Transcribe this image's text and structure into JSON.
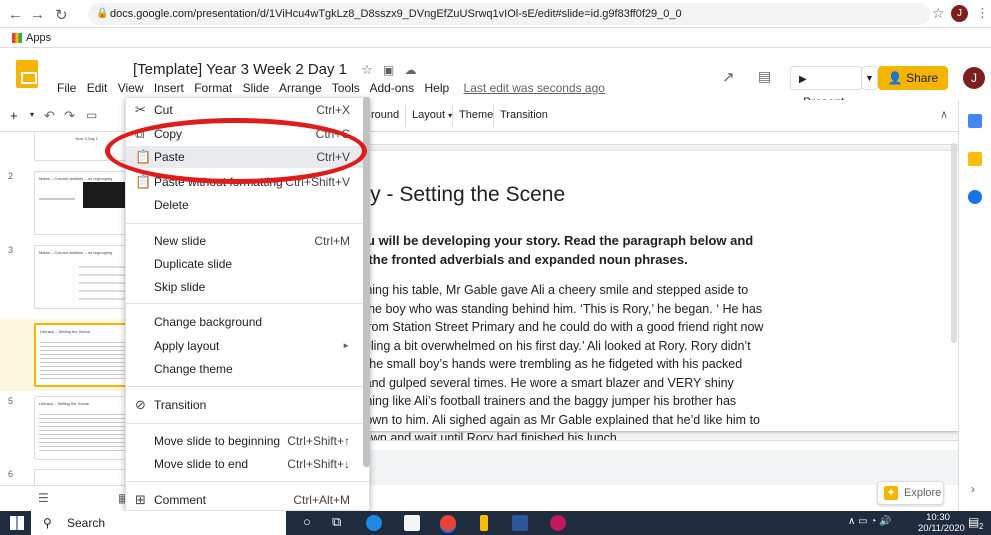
{
  "browser": {
    "url": "docs.google.com/presentation/d/1ViHcu4wTgkLz8_D8sszx9_DVngEfZuUSrwq1vIOl-sE/edit#slide=id.g9f83ff0f29_0_0",
    "bookmarks_label": "Apps",
    "profile_initial": "J"
  },
  "app": {
    "title": "[Template] Year 3 Week 2 Day 1",
    "menus": [
      "File",
      "Edit",
      "View",
      "Insert",
      "Format",
      "Slide",
      "Arrange",
      "Tools",
      "Add-ons",
      "Help"
    ],
    "last_edit": "Last edit was seconds ago",
    "present_label": "Present",
    "share_label": "Share",
    "user_initial": "J"
  },
  "toolbar": {
    "background_label": "round",
    "layout_label": "Layout",
    "theme_label": "Theme",
    "transition_label": "Transition"
  },
  "filmstrip": {
    "slides": [
      {
        "num": "",
        "title": "Year 3 Day 1"
      },
      {
        "num": "2",
        "title": "Maths – Column addition – no regrouping"
      },
      {
        "num": "3",
        "title": "Maths – Column addition – no regrouping"
      },
      {
        "num": "4",
        "title": "Literacy – Setting the Scene"
      },
      {
        "num": "5",
        "title": "Literacy – Setting the Scene"
      },
      {
        "num": "6",
        "title": ""
      }
    ]
  },
  "slide": {
    "title": "racy - Setting the Scene",
    "bold_text": "y you will be developing your story. Read the paragraph below and ight the fronted adverbials and expanded noun phrases.",
    "lines": [
      "reaching his table, Mr Gable gave Ali a cheery smile and stepped aside to",
      "uce the boy who was standing behind him. ‘This is Rory,’ he began. ‘ He has",
      "l us from Station Street Primary and he could do with a good friend right now",
      "is feeling a bit overwhelmed on his first day.’ Ali looked at Rory. Rory didn’t",
      "up. The small boy’s hands were trembling as he fidgeted with his packed",
      "box and gulped several times. He wore a smart blazer and VERY shiny",
      ", nothing like Ali’s football trainers and the baggy jumper his brother has",
      "ed down to him. Ali sighed again as Mr Gable explained that he’d like him to",
      "ck down and wait until Rory had finished his lunch."
    ]
  },
  "explore_label": "Explore",
  "context_menu": {
    "items": [
      {
        "icon": "✂",
        "label": "Cut",
        "shortcut": "Ctrl+X"
      },
      {
        "icon": "⧉",
        "label": "Copy",
        "shortcut": "Ctrl+C"
      },
      {
        "icon": "📋",
        "label": "Paste",
        "shortcut": "Ctrl+V"
      },
      {
        "icon": "📋",
        "label": "Paste without formatting",
        "shortcut": "Ctrl+Shift+V"
      },
      {
        "icon": "",
        "label": "Delete",
        "shortcut": ""
      },
      {
        "icon": "",
        "label": "New slide",
        "shortcut": "Ctrl+M"
      },
      {
        "icon": "",
        "label": "Duplicate slide",
        "shortcut": ""
      },
      {
        "icon": "",
        "label": "Skip slide",
        "shortcut": ""
      },
      {
        "icon": "",
        "label": "Change background",
        "shortcut": ""
      },
      {
        "icon": "",
        "label": "Apply layout",
        "shortcut": "►"
      },
      {
        "icon": "",
        "label": "Change theme",
        "shortcut": ""
      },
      {
        "icon": "⊘",
        "label": "Transition",
        "shortcut": ""
      },
      {
        "icon": "",
        "label": "Move slide to beginning",
        "shortcut": "Ctrl+Shift+↑"
      },
      {
        "icon": "",
        "label": "Move slide to end",
        "shortcut": "Ctrl+Shift+↓"
      },
      {
        "icon": "⊞",
        "label": "Comment",
        "shortcut": "Ctrl+Alt+M"
      }
    ]
  },
  "taskbar": {
    "search_placeholder": "Search",
    "time": "10:30",
    "date": "20/11/2020",
    "notification_count": "2"
  },
  "colors": {
    "accent": "#f4b400",
    "highlight_ring": "#e01b1b",
    "taskbar": "#1f2b3e"
  }
}
